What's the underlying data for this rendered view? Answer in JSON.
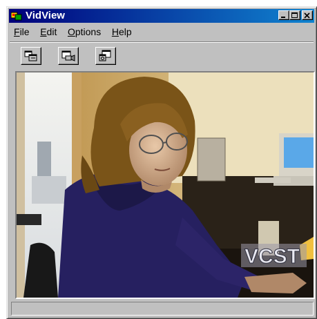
{
  "window": {
    "title": "VidView",
    "icon": "vidview-app-icon",
    "buttons": [
      "minimize-icon",
      "maximize-icon",
      "close-icon"
    ]
  },
  "menu": {
    "items": [
      {
        "label": "File",
        "accel": "F"
      },
      {
        "label": "Edit",
        "accel": "E"
      },
      {
        "label": "Options",
        "accel": "O"
      },
      {
        "label": "Help",
        "accel": "H"
      }
    ]
  },
  "toolbar": {
    "buttons": [
      {
        "icon": "dual-window-icon"
      },
      {
        "icon": "camera-window-icon"
      },
      {
        "icon": "snapshot-window-icon"
      }
    ]
  },
  "video": {
    "watermark": "VCST",
    "description_icon": "video-feed"
  },
  "status": {
    "text": ""
  },
  "colors": {
    "title_start": "#00007b",
    "title_end": "#1084d0",
    "face": "#c0c0c0"
  }
}
